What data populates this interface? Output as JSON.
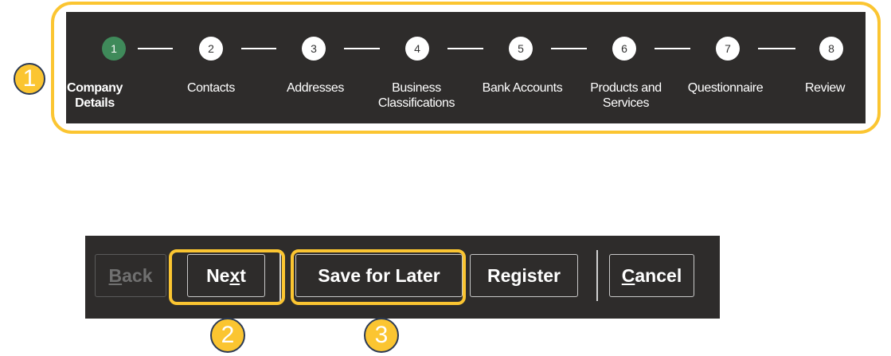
{
  "steps": [
    {
      "number": "1",
      "label": "Company\nDetails",
      "active": true
    },
    {
      "number": "2",
      "label": "Contacts",
      "active": false
    },
    {
      "number": "3",
      "label": "Addresses",
      "active": false
    },
    {
      "number": "4",
      "label": "Business\nClassifications",
      "active": false
    },
    {
      "number": "5",
      "label": "Bank Accounts",
      "active": false
    },
    {
      "number": "6",
      "label": "Products and\nServices",
      "active": false
    },
    {
      "number": "7",
      "label": "Questionnaire",
      "active": false
    },
    {
      "number": "8",
      "label": "Review",
      "active": false
    }
  ],
  "toolbar": {
    "back": {
      "pre": "",
      "key": "B",
      "post": "ack"
    },
    "next": {
      "pre": "Ne",
      "key": "x",
      "post": "t"
    },
    "save_for_later": "Save for Later",
    "register": "Register",
    "cancel": {
      "pre": "",
      "key": "C",
      "post": "ancel"
    }
  },
  "callouts": {
    "c1": "1",
    "c2": "2",
    "c3": "3"
  },
  "colors": {
    "highlight": "#fbc531",
    "dark_bar": "#2e2c2b",
    "active_step": "#3f8a5a",
    "callout_border": "#2b3a55"
  }
}
